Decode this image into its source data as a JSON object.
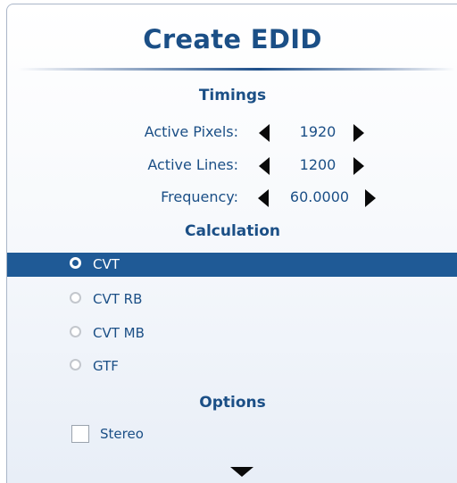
{
  "title": "Create EDID",
  "timings": {
    "heading": "Timings",
    "rows": [
      {
        "label": "Active Pixels:",
        "value": "1920"
      },
      {
        "label": "Active Lines:",
        "value": "1200"
      },
      {
        "label": "Frequency:",
        "value": "60.0000"
      }
    ]
  },
  "calculation": {
    "heading": "Calculation",
    "options": [
      {
        "label": "CVT",
        "selected": true
      },
      {
        "label": "CVT RB",
        "selected": false
      },
      {
        "label": "CVT MB",
        "selected": false
      },
      {
        "label": "GTF",
        "selected": false
      }
    ]
  },
  "options": {
    "heading": "Options",
    "stereo": {
      "label": "Stereo",
      "checked": false
    }
  },
  "colors": {
    "accent": "#1b4f86",
    "selection": "#1f5a96"
  },
  "icons": {
    "decrement": "triangle-left-icon",
    "increment": "triangle-right-icon",
    "scroll": "triangle-down-icon"
  }
}
